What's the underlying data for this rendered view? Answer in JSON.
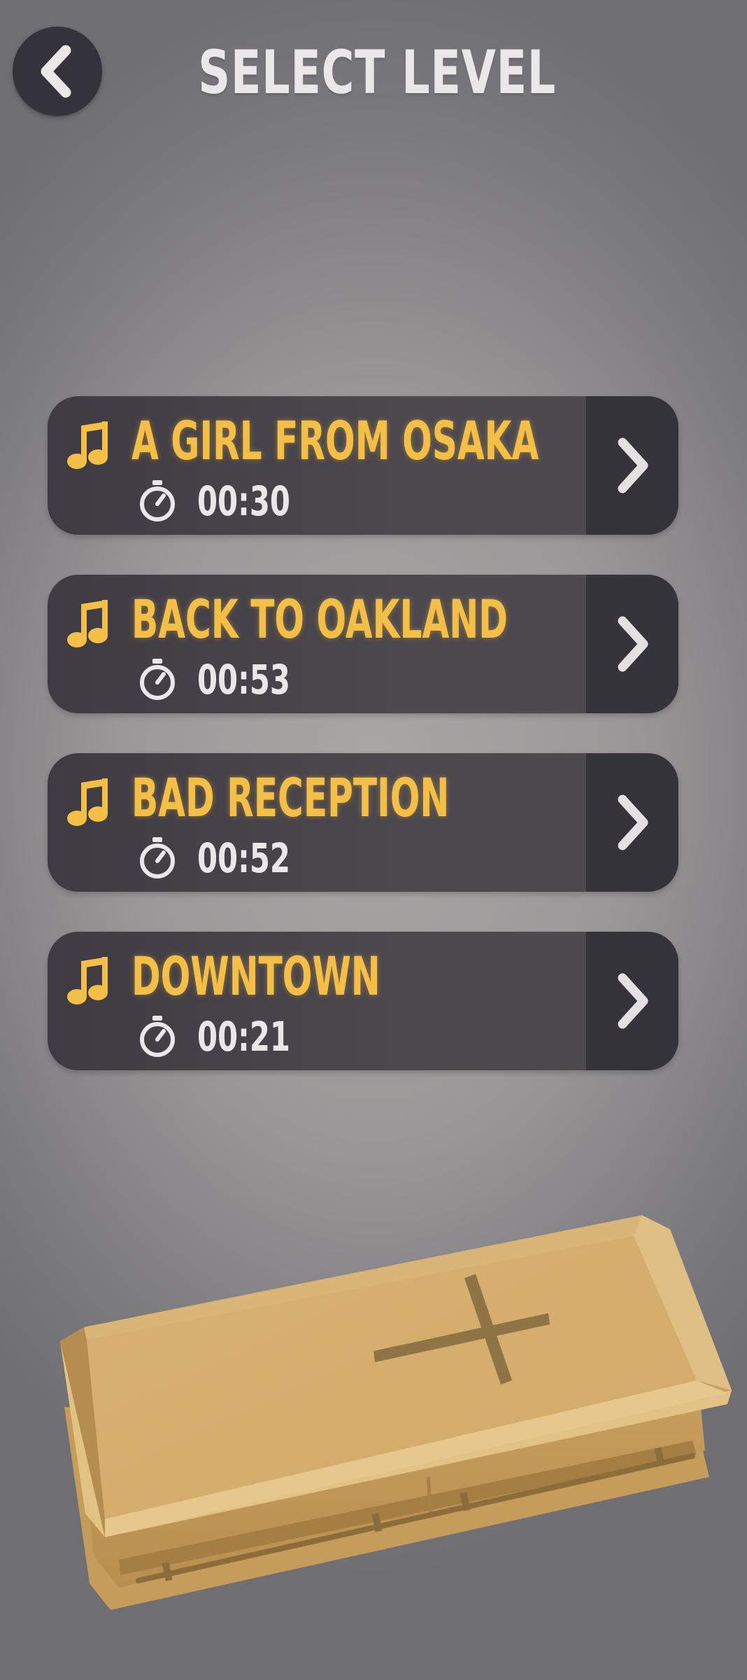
{
  "header": {
    "title": "SELECT LEVEL",
    "back_icon": "chevron-left-icon"
  },
  "levels": [
    {
      "title": "A GIRL FROM OSAKA",
      "duration": "00:30"
    },
    {
      "title": "BACK TO OAKLAND",
      "duration": "00:53"
    },
    {
      "title": "BAD RECEPTION",
      "duration": "00:52"
    },
    {
      "title": "DOWNTOWN",
      "duration": "00:21"
    }
  ],
  "icons": {
    "song": "music-note-icon",
    "duration": "stopwatch-icon",
    "play": "chevron-right-icon"
  },
  "colors": {
    "accent": "#f3bf47",
    "card": "#48454c",
    "card_arrow": "#36343b",
    "text_light": "#e9e7e7",
    "background": "#9c9899",
    "coffin_wood": "#d4ab6a"
  },
  "scene": {
    "decoration": "coffin-with-cross"
  }
}
